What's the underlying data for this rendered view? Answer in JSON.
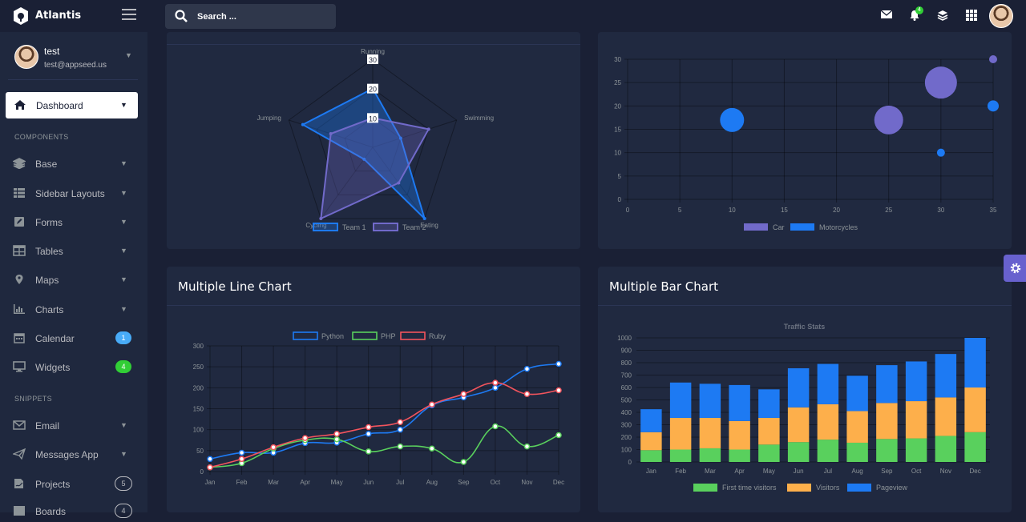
{
  "brand": {
    "name": "Atlantis"
  },
  "user": {
    "name": "test",
    "email": "test@appseed.us"
  },
  "search": {
    "placeholder": "Search ..."
  },
  "topbar": {
    "notifications_count": "4"
  },
  "sidebar": {
    "active": {
      "label": "Dashboard"
    },
    "sections": [
      "COMPONENTS",
      "SNIPPETS"
    ],
    "items": [
      {
        "label": "Base",
        "icon": "layers-icon"
      },
      {
        "label": "Sidebar Layouts",
        "icon": "th-list-icon"
      },
      {
        "label": "Forms",
        "icon": "pen-square-icon"
      },
      {
        "label": "Tables",
        "icon": "table-icon"
      },
      {
        "label": "Maps",
        "icon": "map-marker-icon"
      },
      {
        "label": "Charts",
        "icon": "chart-bar-icon"
      },
      {
        "label": "Calendar",
        "icon": "calendar-icon",
        "badge": "1",
        "badge_color": "#48abf7"
      },
      {
        "label": "Widgets",
        "icon": "desktop-icon",
        "badge": "4",
        "badge_color": "#31ce36"
      },
      {
        "label": "Email",
        "icon": "envelope-icon"
      },
      {
        "label": "Messages App",
        "icon": "paper-plane-icon"
      },
      {
        "label": "Projects",
        "icon": "file-signature-icon",
        "badge": "5"
      },
      {
        "label": "Boards",
        "icon": "board-icon",
        "badge": "4"
      }
    ]
  },
  "cards": {
    "line_title": "Multiple Line Chart",
    "bar_title": "Multiple Bar Chart"
  },
  "colors": {
    "blue": "#1d7af3",
    "purple": "#716aca",
    "green": "#59d05d",
    "orange": "#fdaf4b",
    "red": "#f3545d",
    "accent": "#6861ce"
  },
  "chart_data": [
    {
      "type": "radar",
      "categories": [
        "Running",
        "Swimming",
        "Eating",
        "Cycling",
        "Jumping"
      ],
      "rlim": [
        0,
        30
      ],
      "tick_labels": [
        "30",
        "20",
        "10"
      ],
      "series": [
        {
          "name": "Team 1",
          "values": [
            20,
            10,
            30,
            5,
            25
          ]
        },
        {
          "name": "Team 2",
          "values": [
            10,
            20,
            15,
            30,
            15
          ]
        }
      ],
      "legend": "bottom"
    },
    {
      "type": "scatter",
      "subtype": "bubble",
      "xlim": [
        0,
        35
      ],
      "ylim": [
        0,
        30
      ],
      "xticks": [
        0,
        5,
        10,
        15,
        20,
        25,
        30,
        35
      ],
      "yticks": [
        0,
        5,
        10,
        15,
        20,
        25,
        30
      ],
      "series": [
        {
          "name": "Car",
          "points": [
            {
              "x": 25,
              "y": 17,
              "r": 18
            },
            {
              "x": 30,
              "y": 25,
              "r": 20
            },
            {
              "x": 35,
              "y": 30,
              "r": 5
            }
          ]
        },
        {
          "name": "Motorcycles",
          "points": [
            {
              "x": 10,
              "y": 17,
              "r": 15
            },
            {
              "x": 30,
              "y": 10,
              "r": 5
            },
            {
              "x": 35,
              "y": 20,
              "r": 7
            }
          ]
        }
      ],
      "legend": "bottom"
    },
    {
      "type": "line",
      "categories": [
        "Jan",
        "Feb",
        "Mar",
        "Apr",
        "May",
        "Jun",
        "Jul",
        "Aug",
        "Sep",
        "Oct",
        "Nov",
        "Dec"
      ],
      "ylim": [
        0,
        300
      ],
      "yticks": [
        0,
        50,
        100,
        150,
        200,
        250,
        300
      ],
      "series": [
        {
          "name": "Python",
          "values": [
            30,
            45,
            45,
            68,
            69,
            90,
            100,
            158,
            177,
            200,
            245,
            257
          ]
        },
        {
          "name": "PHP",
          "values": [
            10,
            20,
            55,
            75,
            77,
            48,
            60,
            55,
            23,
            108,
            60,
            87
          ]
        },
        {
          "name": "Ruby",
          "values": [
            10,
            30,
            58,
            80,
            90,
            106,
            118,
            160,
            185,
            212,
            185,
            194
          ]
        }
      ],
      "legend": "top"
    },
    {
      "type": "bar",
      "stacked": true,
      "title": "Traffic Stats",
      "categories": [
        "Jan",
        "Feb",
        "Mar",
        "Apr",
        "May",
        "Jun",
        "Jul",
        "Aug",
        "Sep",
        "Oct",
        "Nov",
        "Dec"
      ],
      "ylim": [
        0,
        1000
      ],
      "yticks": [
        0,
        100,
        200,
        300,
        400,
        500,
        600,
        700,
        800,
        900,
        1000
      ],
      "series": [
        {
          "name": "First time visitors",
          "values": [
            95,
            100,
            110,
            100,
            140,
            160,
            180,
            155,
            185,
            190,
            210,
            240
          ]
        },
        {
          "name": "Visitors",
          "values": [
            145,
            255,
            245,
            230,
            215,
            280,
            285,
            255,
            290,
            300,
            310,
            360
          ]
        },
        {
          "name": "Pageview",
          "values": [
            185,
            285,
            275,
            290,
            230,
            315,
            325,
            285,
            305,
            320,
            350,
            400
          ]
        }
      ],
      "legend": "bottom"
    }
  ]
}
